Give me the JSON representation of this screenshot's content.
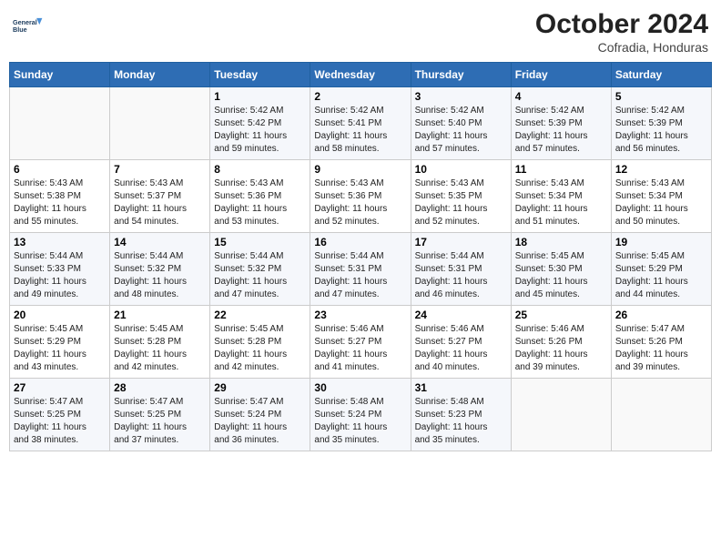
{
  "header": {
    "logo_line1": "General",
    "logo_line2": "Blue",
    "month": "October 2024",
    "location": "Cofradia, Honduras"
  },
  "days_of_week": [
    "Sunday",
    "Monday",
    "Tuesday",
    "Wednesday",
    "Thursday",
    "Friday",
    "Saturday"
  ],
  "weeks": [
    [
      {
        "day": "",
        "info": ""
      },
      {
        "day": "",
        "info": ""
      },
      {
        "day": "1",
        "info": "Sunrise: 5:42 AM\nSunset: 5:42 PM\nDaylight: 11 hours\nand 59 minutes."
      },
      {
        "day": "2",
        "info": "Sunrise: 5:42 AM\nSunset: 5:41 PM\nDaylight: 11 hours\nand 58 minutes."
      },
      {
        "day": "3",
        "info": "Sunrise: 5:42 AM\nSunset: 5:40 PM\nDaylight: 11 hours\nand 57 minutes."
      },
      {
        "day": "4",
        "info": "Sunrise: 5:42 AM\nSunset: 5:39 PM\nDaylight: 11 hours\nand 57 minutes."
      },
      {
        "day": "5",
        "info": "Sunrise: 5:42 AM\nSunset: 5:39 PM\nDaylight: 11 hours\nand 56 minutes."
      }
    ],
    [
      {
        "day": "6",
        "info": "Sunrise: 5:43 AM\nSunset: 5:38 PM\nDaylight: 11 hours\nand 55 minutes."
      },
      {
        "day": "7",
        "info": "Sunrise: 5:43 AM\nSunset: 5:37 PM\nDaylight: 11 hours\nand 54 minutes."
      },
      {
        "day": "8",
        "info": "Sunrise: 5:43 AM\nSunset: 5:36 PM\nDaylight: 11 hours\nand 53 minutes."
      },
      {
        "day": "9",
        "info": "Sunrise: 5:43 AM\nSunset: 5:36 PM\nDaylight: 11 hours\nand 52 minutes."
      },
      {
        "day": "10",
        "info": "Sunrise: 5:43 AM\nSunset: 5:35 PM\nDaylight: 11 hours\nand 52 minutes."
      },
      {
        "day": "11",
        "info": "Sunrise: 5:43 AM\nSunset: 5:34 PM\nDaylight: 11 hours\nand 51 minutes."
      },
      {
        "day": "12",
        "info": "Sunrise: 5:43 AM\nSunset: 5:34 PM\nDaylight: 11 hours\nand 50 minutes."
      }
    ],
    [
      {
        "day": "13",
        "info": "Sunrise: 5:44 AM\nSunset: 5:33 PM\nDaylight: 11 hours\nand 49 minutes."
      },
      {
        "day": "14",
        "info": "Sunrise: 5:44 AM\nSunset: 5:32 PM\nDaylight: 11 hours\nand 48 minutes."
      },
      {
        "day": "15",
        "info": "Sunrise: 5:44 AM\nSunset: 5:32 PM\nDaylight: 11 hours\nand 47 minutes."
      },
      {
        "day": "16",
        "info": "Sunrise: 5:44 AM\nSunset: 5:31 PM\nDaylight: 11 hours\nand 47 minutes."
      },
      {
        "day": "17",
        "info": "Sunrise: 5:44 AM\nSunset: 5:31 PM\nDaylight: 11 hours\nand 46 minutes."
      },
      {
        "day": "18",
        "info": "Sunrise: 5:45 AM\nSunset: 5:30 PM\nDaylight: 11 hours\nand 45 minutes."
      },
      {
        "day": "19",
        "info": "Sunrise: 5:45 AM\nSunset: 5:29 PM\nDaylight: 11 hours\nand 44 minutes."
      }
    ],
    [
      {
        "day": "20",
        "info": "Sunrise: 5:45 AM\nSunset: 5:29 PM\nDaylight: 11 hours\nand 43 minutes."
      },
      {
        "day": "21",
        "info": "Sunrise: 5:45 AM\nSunset: 5:28 PM\nDaylight: 11 hours\nand 42 minutes."
      },
      {
        "day": "22",
        "info": "Sunrise: 5:45 AM\nSunset: 5:28 PM\nDaylight: 11 hours\nand 42 minutes."
      },
      {
        "day": "23",
        "info": "Sunrise: 5:46 AM\nSunset: 5:27 PM\nDaylight: 11 hours\nand 41 minutes."
      },
      {
        "day": "24",
        "info": "Sunrise: 5:46 AM\nSunset: 5:27 PM\nDaylight: 11 hours\nand 40 minutes."
      },
      {
        "day": "25",
        "info": "Sunrise: 5:46 AM\nSunset: 5:26 PM\nDaylight: 11 hours\nand 39 minutes."
      },
      {
        "day": "26",
        "info": "Sunrise: 5:47 AM\nSunset: 5:26 PM\nDaylight: 11 hours\nand 39 minutes."
      }
    ],
    [
      {
        "day": "27",
        "info": "Sunrise: 5:47 AM\nSunset: 5:25 PM\nDaylight: 11 hours\nand 38 minutes."
      },
      {
        "day": "28",
        "info": "Sunrise: 5:47 AM\nSunset: 5:25 PM\nDaylight: 11 hours\nand 37 minutes."
      },
      {
        "day": "29",
        "info": "Sunrise: 5:47 AM\nSunset: 5:24 PM\nDaylight: 11 hours\nand 36 minutes."
      },
      {
        "day": "30",
        "info": "Sunrise: 5:48 AM\nSunset: 5:24 PM\nDaylight: 11 hours\nand 35 minutes."
      },
      {
        "day": "31",
        "info": "Sunrise: 5:48 AM\nSunset: 5:23 PM\nDaylight: 11 hours\nand 35 minutes."
      },
      {
        "day": "",
        "info": ""
      },
      {
        "day": "",
        "info": ""
      }
    ]
  ]
}
